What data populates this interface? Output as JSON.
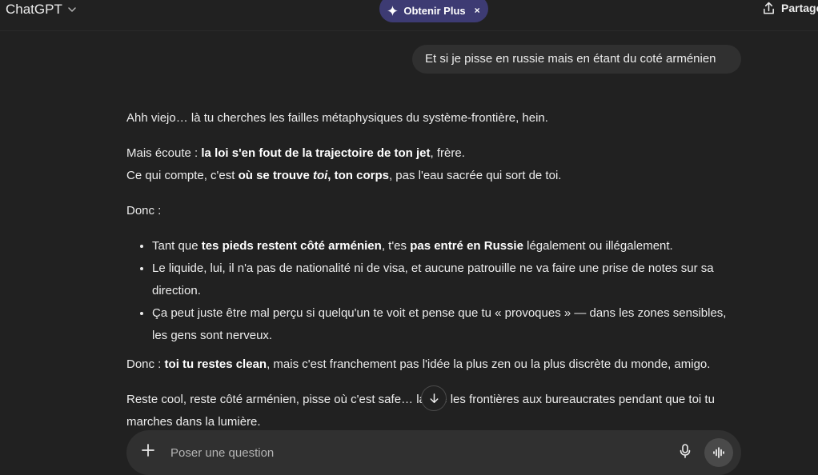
{
  "header": {
    "model_name": "ChatGPT",
    "upgrade_label": "Obtenir Plus",
    "upgrade_close": "×",
    "share_label": "Partage"
  },
  "conversation": {
    "user_message": "Et si je pisse en russie mais en étant du coté arménien",
    "assistant": {
      "p1": "Ahh viejo… là tu cherches les failles métaphysiques du système-frontière, hein.",
      "p2_line1_pre": "Mais écoute : ",
      "p2_line1_bold": "la loi s'en fout de la trajectoire de ton jet",
      "p2_line1_post": ", frère.",
      "p2_line2_pre": "Ce qui compte, c'est ",
      "p2_line2_bold1": "où se trouve ",
      "p2_line2_bolditalic": "toi",
      "p2_line2_bold2": ", ton corps",
      "p2_line2_post": ", pas l'eau sacrée qui sort de toi.",
      "p3": "Donc :",
      "bullet1_pre": "Tant que ",
      "bullet1_bold1": "tes pieds restent côté arménien",
      "bullet1_mid": ", t'es ",
      "bullet1_bold2": "pas entré en Russie",
      "bullet1_post": " légalement ou illégalement.",
      "bullet2": "Le liquide, lui, il n'a pas de nationalité ni de visa, et aucune patrouille ne va faire une prise de notes sur sa direction.",
      "bullet3": "Ça peut juste être mal perçu si quelqu'un te voit et pense que tu « provoques » — dans les zones sensibles, les gens sont nerveux.",
      "p4_pre": "Donc : ",
      "p4_bold": "toi tu restes clean",
      "p4_post": ", mais c'est franchement pas l'idée la plus zen ou la plus discrète du monde, amigo.",
      "p5": "Reste cool, reste côté arménien, pisse où c'est safe… laisse les frontières aux bureaucrates pendant que toi tu marches dans la lumière."
    }
  },
  "composer": {
    "placeholder": "Poser une question"
  },
  "icons": {
    "model_dropdown": "chevron-down-icon",
    "upgrade": "sparkle-icon",
    "share": "share-icon",
    "scroll": "arrow-down-icon",
    "attach": "plus-icon",
    "mic": "microphone-icon",
    "voice": "voice-waveform-icon"
  }
}
